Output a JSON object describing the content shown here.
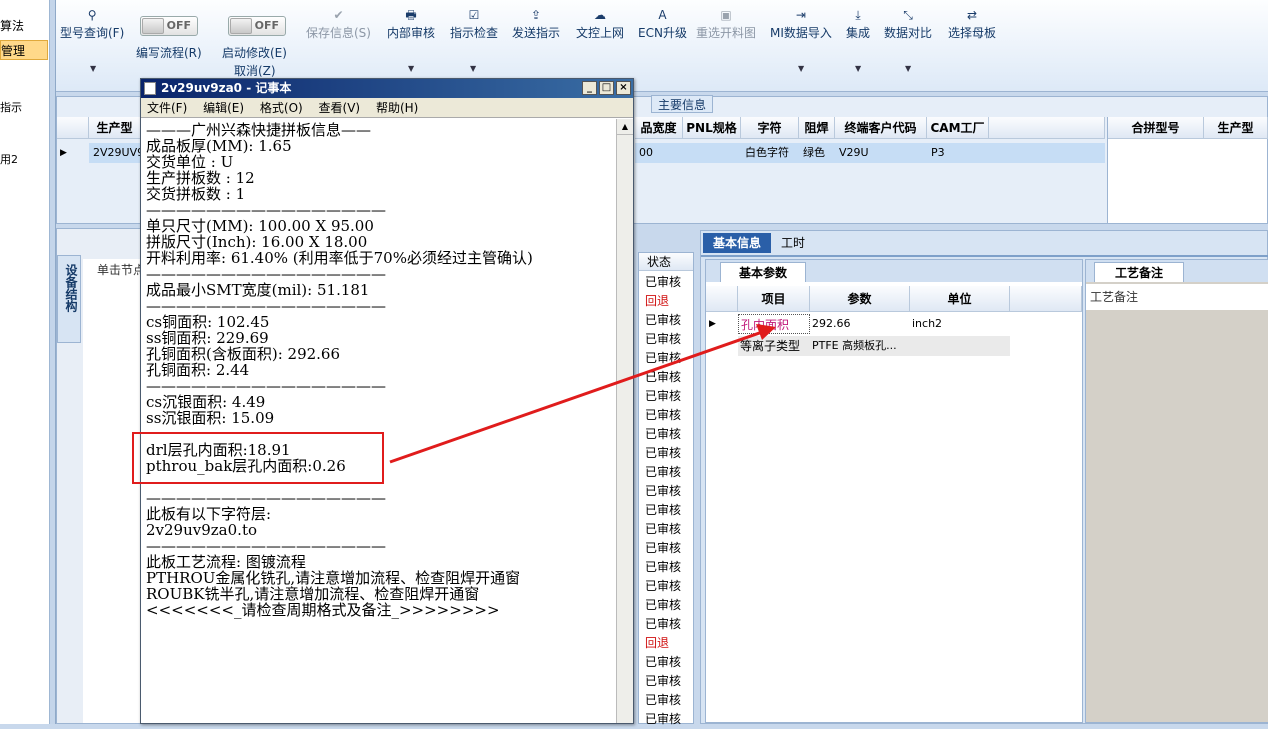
{
  "left_nav": {
    "items": [
      "算法",
      "管理",
      "指示",
      "用2"
    ]
  },
  "toolbar": {
    "buttons": [
      {
        "label": "型号查询(F)",
        "icon": "search-icon"
      },
      {
        "label": "保存信息(S)",
        "icon": "check-icon"
      },
      {
        "label": "内部审核",
        "icon": "print-icon"
      },
      {
        "label": "指示检查",
        "icon": "checkbox-icon"
      },
      {
        "label": "发送指示",
        "icon": "upload-icon"
      },
      {
        "label": "文控上网",
        "icon": "cloud-upload-icon"
      },
      {
        "label": "ECN升级",
        "icon": "text-a-icon"
      },
      {
        "label": "重选开料图",
        "icon": "image-icon"
      },
      {
        "label": "MI数据导入",
        "icon": "import-icon"
      },
      {
        "label": "集成",
        "icon": "download-icon"
      },
      {
        "label": "数据对比",
        "icon": "compare-icon"
      },
      {
        "label": "选择母板",
        "icon": "shuffle-icon"
      }
    ],
    "toggles": [
      {
        "label": "编写流程(R)",
        "state": "OFF"
      },
      {
        "label": "启动修改(E)",
        "state": "OFF"
      }
    ],
    "cancel_label": "取消(Z)"
  },
  "main_grid": {
    "group_label": "主要信息",
    "left_header": "生产型",
    "row_left_value": "2V29UV9Z",
    "columns": [
      "品宽度",
      "PNL规格",
      "字符",
      "阻焊",
      "终端客户代码",
      "CAM工厂"
    ],
    "row": [
      "00",
      "",
      "白色字符",
      "绿色",
      "V29U",
      "P3"
    ],
    "right_columns": [
      "合拼型号",
      "生产型"
    ]
  },
  "lower_left": {
    "tab_label": "设备结构",
    "header": "单击节点"
  },
  "status_column": {
    "header": "状态",
    "values": [
      "已审核",
      "回退",
      "已审核",
      "已审核",
      "已审核",
      "已审核",
      "已审核",
      "已审核",
      "已审核",
      "已审核",
      "已审核",
      "已审核",
      "已审核",
      "已审核",
      "已审核",
      "已审核",
      "已审核",
      "已审核",
      "已审核",
      "回退",
      "已审核",
      "已审核",
      "已审核",
      "已审核"
    ]
  },
  "right_panel": {
    "tabs": [
      "基本信息",
      "工时"
    ],
    "subtab": "基本参数",
    "craft_tab": "工艺备注",
    "craft_header": "工艺备注",
    "columns": [
      "项目",
      "参数",
      "单位"
    ],
    "rows": [
      {
        "item": "孔内面积",
        "param": "292.66",
        "unit": "inch2"
      },
      {
        "item": "等离子类型",
        "param": "PTFE 高频板孔...",
        "unit": ""
      }
    ]
  },
  "notepad": {
    "title": "2v29uv9za0 - 记事本",
    "menu": [
      "文件(F)",
      "编辑(E)",
      "格式(O)",
      "查看(V)",
      "帮助(H)"
    ],
    "lines": [
      "———广州兴森快捷拼板信息——",
      "成品板厚(MM): 1.65",
      "交货单位 : U",
      "生产拼板数 : 12",
      "交货拼板数 : 1",
      "————————————————",
      "单只尺寸(MM): 100.00 X 95.00",
      "拼版尺寸(Inch): 16.00 X 18.00",
      "开料利用率: 61.40% (利用率低于70%必须经过主管确认)",
      "————————————————",
      "成品最小SMT宽度(mil): 51.181",
      "————————————————",
      "cs铜面积: 102.45",
      "ss铜面积: 229.69",
      "孔铜面积(含板面积): 292.66",
      "孔铜面积: 2.44",
      "————————————————",
      "cs沉银面积: 4.49",
      "ss沉银面积: 15.09",
      "",
      "drl层孔内面积:18.91",
      "pthrou_bak层孔内面积:0.26",
      "",
      "————————————————",
      "此板有以下字符层:",
      "2v29uv9za0.to",
      "————————————————",
      "此板工艺流程: 图镀流程",
      "PTHROU金属化铣孔,请注意增加流程、检查阻焊开通窗",
      "ROUBK铣半孔,请注意增加流程、检查阻焊开通窗",
      "<<<<<<<_请检查周期格式及备注_>>>>>>>>"
    ]
  },
  "colors": {
    "annotation_red": "#e01c1c",
    "selection_blue": "#c6ddf5",
    "status_back_red": "#d01010"
  }
}
